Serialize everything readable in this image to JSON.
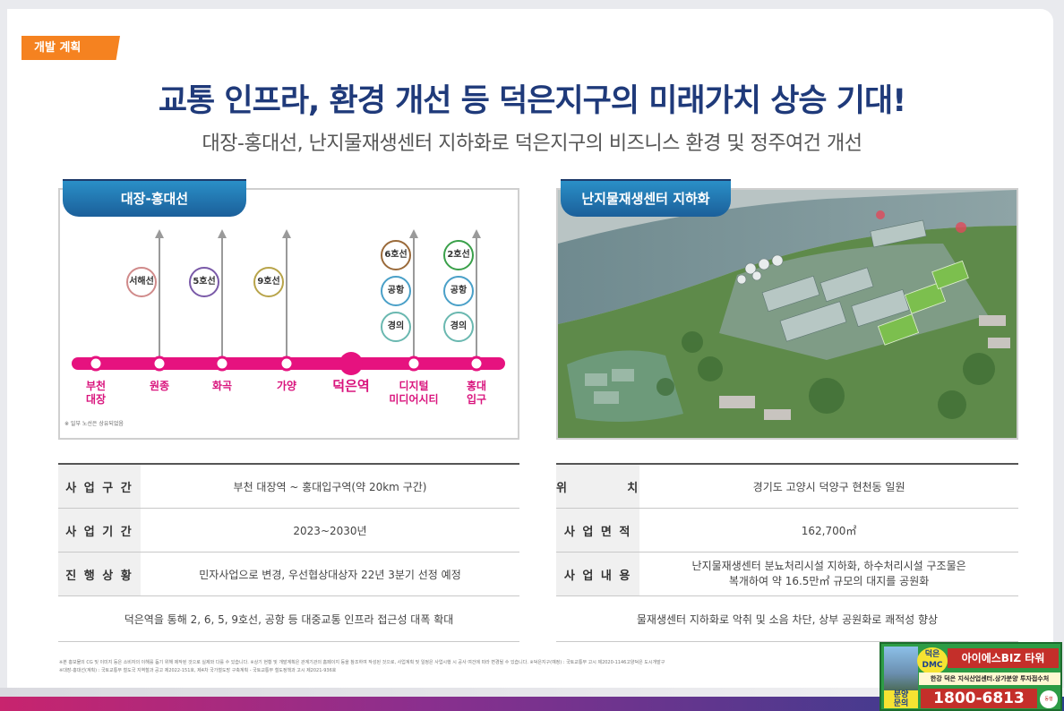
{
  "header": {
    "tag": "개발 계획",
    "title": "교통 인프라, 환경 개선 등 덕은지구의 미래가치 상승 기대!",
    "subtitle": "대장-홍대선, 난지물재생센터 지하화로 덕은지구의 비즈니스 환경 및 정주여건 개선"
  },
  "left_panel": {
    "tab": "대장-홍대선",
    "note": "※ 일부 노선은 상유되었음",
    "line_color": "#e6127f",
    "stations": [
      {
        "label": "부천\n대장"
      },
      {
        "label": "원종"
      },
      {
        "label": "화곡"
      },
      {
        "label": "가양"
      },
      {
        "label": "덕은역"
      },
      {
        "label": "디지털\n미디어시티"
      },
      {
        "label": "홍대\n입구"
      }
    ],
    "transfers": [
      {
        "station": 1,
        "badges": [
          {
            "label": "서해선",
            "color": "#d08a8a"
          }
        ]
      },
      {
        "station": 2,
        "badges": [
          {
            "label": "5호선",
            "color": "#7a5aa8"
          }
        ]
      },
      {
        "station": 3,
        "badges": [
          {
            "label": "9호선",
            "color": "#b8a44a"
          }
        ]
      },
      {
        "station": 5,
        "badges": [
          {
            "label": "6호선",
            "color": "#9a6a3a"
          },
          {
            "label": "공항",
            "color": "#4aa0c8"
          },
          {
            "label": "경의",
            "color": "#6ab8b0"
          }
        ]
      },
      {
        "station": 6,
        "badges": [
          {
            "label": "2호선",
            "color": "#3aa04a"
          },
          {
            "label": "공항",
            "color": "#4aa0c8"
          },
          {
            "label": "경의",
            "color": "#6ab8b0"
          }
        ]
      }
    ]
  },
  "right_panel": {
    "tab": "난지물재생센터 지하화"
  },
  "left_table": {
    "rows": [
      {
        "head": "사 업 구 간",
        "value": "부천 대장역 ~ 홍대입구역(약 20km 구간)"
      },
      {
        "head": "사 업 기 간",
        "value": "2023~2030년"
      },
      {
        "head": "진 행 상 황",
        "value": "민자사업으로 변경, 우선협상대상자 22년 3분기 선정 예정"
      }
    ],
    "summary": "덕은역을 통해 2, 6, 5, 9호선, 공항 등 대중교통 인프라 접근성 대폭 확대"
  },
  "right_table": {
    "rows": [
      {
        "head": "위          치",
        "value": "경기도 고양시 덕양구 현천동 일원"
      },
      {
        "head": "사 업 면 적",
        "value": "162,700㎡"
      },
      {
        "head": "사 업 내 용",
        "value": "난지물재생센터 분뇨처리시설 지하화, 하수처리시설 구조물은\n복개하여 약 16.5만㎡ 규모의 대지를 공원화"
      }
    ],
    "summary": "물재생센터 지하화로 악취 및 소음 차단, 상부 공원화로 쾌적성 향상"
  },
  "footnotes": [
    "※본 홍보물의 CG 및 이미지 등은 소비자의 이해를 돕기 위해 제작된 것으로 실제와 다를 수 있습니다. ※상기 현황 및 개발계획은 관계기관의 홈페이지 등을 참조하여 작성된 것으로, 사업계획 및 일정은 사업시행 시 공사 여건에 따라 변경될 수 있습니다. ※덕은지구(예정) : 국토교통부 고시 제2020-1146고양덕은 도시개발구",
    "※대장-홍대선(계획) : 국토교통부 철도국 지역철과 공고 제2022-151호, 제4차 국가철도망 구축계획 - 국토교통부 철도정책과 고시 제2021-936호"
  ],
  "ad": {
    "badge": "덕은\nDMC",
    "name": "아이에스BIZ 타워",
    "desc": "한강 덕은 지식산업센터.상가분양 투자접수처",
    "inquiry": "분양\n문의",
    "phone": "1800-6813",
    "mini": "동행"
  }
}
